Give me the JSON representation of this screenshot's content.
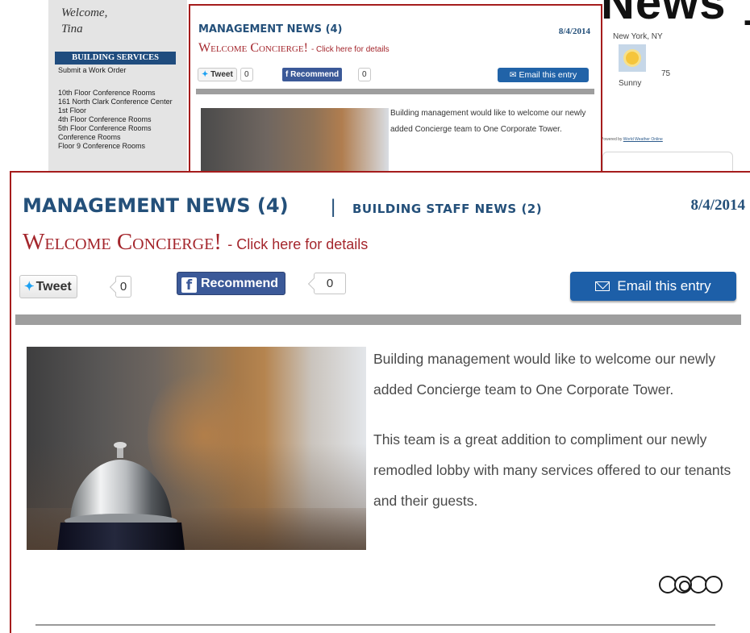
{
  "background": {
    "welcome": "Welcome,",
    "user": "Tina",
    "services_header": "BUILDING SERVICES",
    "links": [
      "Submit a Work Order",
      "10th Floor Conference Rooms",
      "161 North Clark Conference Center",
      "1st Floor",
      "4th Floor Conference Rooms",
      "5th Floor Conference Rooms",
      "Conference Rooms",
      "Floor 9 Conference Rooms"
    ],
    "weather": {
      "city": "New York, NY",
      "temp": "75",
      "condition": "Sunny",
      "powered_prefix": "Powered by",
      "powered_link": "World Weather Online"
    },
    "big_title": "News",
    "big_title_glyph": "T"
  },
  "small_panel": {
    "title": "MANAGEMENT NEWS (4)",
    "date": "8/4/2014",
    "headline": "Welcome Concierge!",
    "details": "- Click here for details",
    "tweet_label": "Tweet",
    "tweet_count": "0",
    "recommend_label": "Recommend",
    "recommend_count": "0",
    "email_label": "Email this entry",
    "body": "Building management would like to welcome our newly added Concierge team to One Corporate Tower."
  },
  "news": {
    "tab_active": "MANAGEMENT NEWS (4)",
    "separator": "|",
    "tab_other": "BUILDING STAFF NEWS (2)",
    "date": "8/4/2014",
    "headline": "Welcome Concierge!",
    "details": "- Click here for details",
    "tweet_label": "Tweet",
    "tweet_count": "0",
    "recommend_label": "Recommend",
    "recommend_count": "0",
    "email_label": "Email this entry",
    "paragraph1": "Building management would like to welcome our newly added Concierge team to One Corporate Tower.",
    "paragraph2": "This team is a great addition to compliment our newly remodled lobby with many services offered to our tenants and their guests.",
    "pager": {
      "total": 4,
      "current": 2
    }
  },
  "colors": {
    "brand_blue": "#24507a",
    "headline_red": "#a4262c",
    "frame_red": "#a51c1c",
    "email_blue": "#1d5fa8",
    "facebook_blue": "#3b5998",
    "twitter_blue": "#1da1f2"
  }
}
